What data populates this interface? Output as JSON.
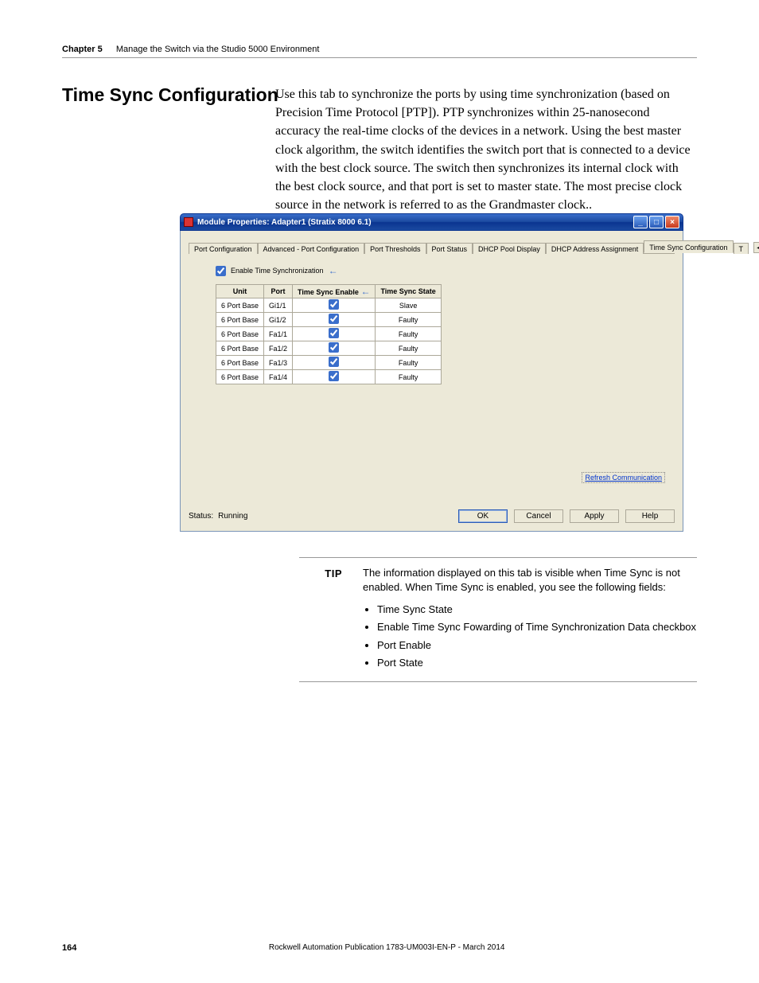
{
  "header": {
    "chapter_label": "Chapter 5",
    "chapter_title": "Manage the Switch via the Studio 5000 Environment"
  },
  "section_title": "Time Sync Configuration",
  "body_paragraph": "Use this tab to synchronize the ports by using time synchronization (based on Precision Time Protocol [PTP]). PTP synchronizes within 25-nanosecond accuracy the real-time clocks of the devices in a network. Using the best master clock algorithm, the switch identifies the switch port that is connected to a device with the best clock source. The switch then synchronizes its internal clock with the best clock source, and that port is set to master state. The most precise clock source in the network is referred to as the Grandmaster clock..",
  "dialog": {
    "title": "Module Properties: Adapter1 (Stratix 8000 6.1)",
    "tabs": [
      "Port Configuration",
      "Advanced - Port Configuration",
      "Port Thresholds",
      "Port Status",
      "DHCP Pool Display",
      "DHCP Address Assignment",
      "Time Sync Configuration"
    ],
    "tab_trailing": "T",
    "active_tab_index": 6,
    "checkbox_label": "Enable Time Synchronization",
    "table": {
      "headers": [
        "Unit",
        "Port",
        "Time Sync Enable",
        "Time Sync State"
      ],
      "rows": [
        {
          "unit": "6 Port Base",
          "port": "Gi1/1",
          "enable": true,
          "state": "Slave"
        },
        {
          "unit": "6 Port Base",
          "port": "Gi1/2",
          "enable": true,
          "state": "Faulty"
        },
        {
          "unit": "6 Port Base",
          "port": "Fa1/1",
          "enable": true,
          "state": "Faulty"
        },
        {
          "unit": "6 Port Base",
          "port": "Fa1/2",
          "enable": true,
          "state": "Faulty"
        },
        {
          "unit": "6 Port Base",
          "port": "Fa1/3",
          "enable": true,
          "state": "Faulty"
        },
        {
          "unit": "6 Port Base",
          "port": "Fa1/4",
          "enable": true,
          "state": "Faulty"
        }
      ]
    },
    "refresh_link": "Refresh Communication",
    "status_label": "Status:",
    "status_value": "Running",
    "buttons": {
      "ok": "OK",
      "cancel": "Cancel",
      "apply": "Apply",
      "help": "Help"
    }
  },
  "tip": {
    "label": "TIP",
    "text": "The information displayed on this tab is visible when Time Sync is not enabled. When Time Sync is enabled, you see the following fields:",
    "bullets": [
      "Time Sync State",
      "Enable Time Sync Fowarding of Time Synchronization Data checkbox",
      "Port Enable",
      "Port State"
    ]
  },
  "footer": {
    "page_number": "164",
    "publication": "Rockwell Automation Publication 1783-UM003I-EN-P - March 2014"
  }
}
